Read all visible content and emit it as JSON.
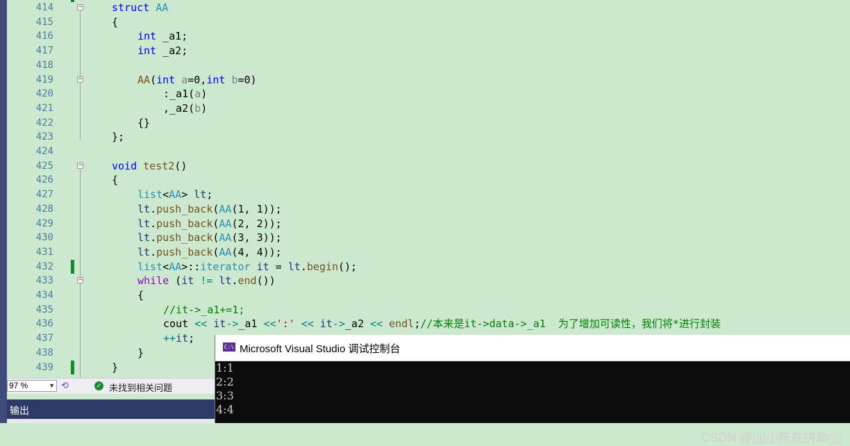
{
  "editor": {
    "line_numbers": [
      "414",
      "415",
      "416",
      "417",
      "418",
      "419",
      "420",
      "421",
      "422",
      "423",
      "424",
      "425",
      "426",
      "427",
      "428",
      "429",
      "430",
      "431",
      "432",
      "433",
      "434",
      "435",
      "436",
      "437",
      "438",
      "439"
    ]
  },
  "statusbar": {
    "zoom": "97 %",
    "issues_text": "未找到相关问题"
  },
  "output_panel": {
    "title": "输出"
  },
  "console": {
    "title": "Microsoft Visual Studio 调试控制台",
    "lines": [
      "1:1",
      "2:2",
      "3:3",
      "4:4"
    ],
    "watermark": "CSDN @▯▯小陈在拼命▯▯"
  },
  "colors": {
    "editor_bg": "#cce8cf",
    "keyword": "#0000ff",
    "type": "#2b91af",
    "comment": "#008000",
    "change_marker": "#108b2c"
  }
}
